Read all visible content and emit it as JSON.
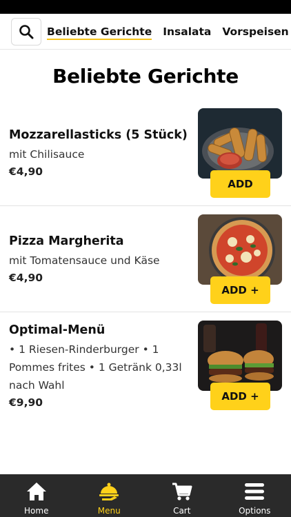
{
  "header": {
    "tabs": [
      {
        "label": "Beliebte Gerichte",
        "active": true
      },
      {
        "label": "Insalata",
        "active": false
      },
      {
        "label": "Vorspeisen",
        "active": false
      }
    ]
  },
  "section": {
    "title": "Beliebte Gerichte"
  },
  "items": [
    {
      "name": "Mozzarellasticks (5 Stück)",
      "description": "mit Chilisauce",
      "price": "€4,90",
      "button": "ADD",
      "image": "mozzarella-sticks-photo"
    },
    {
      "name": "Pizza Margherita",
      "description": "mit Tomatensauce und Käse",
      "price": "€4,90",
      "button": "ADD +",
      "image": "pizza-photo"
    },
    {
      "name": "Optimal-Menü",
      "description": "• 1 Riesen-Rinderburger • 1 Pommes frites • 1 Getränk 0,33l nach Wahl",
      "price": "€9,90",
      "button": "ADD +",
      "image": "burger-photo"
    }
  ],
  "nav": [
    {
      "label": "Home",
      "icon": "home-icon",
      "active": false
    },
    {
      "label": "Menu",
      "icon": "menu-cloche-icon",
      "active": true
    },
    {
      "label": "Cart",
      "icon": "cart-icon",
      "active": false
    },
    {
      "label": "Options",
      "icon": "options-icon",
      "active": false
    }
  ],
  "colors": {
    "accent": "#ffd11a",
    "nav_bg": "#2a2a2a",
    "tab_underline": "#f4c21b"
  }
}
